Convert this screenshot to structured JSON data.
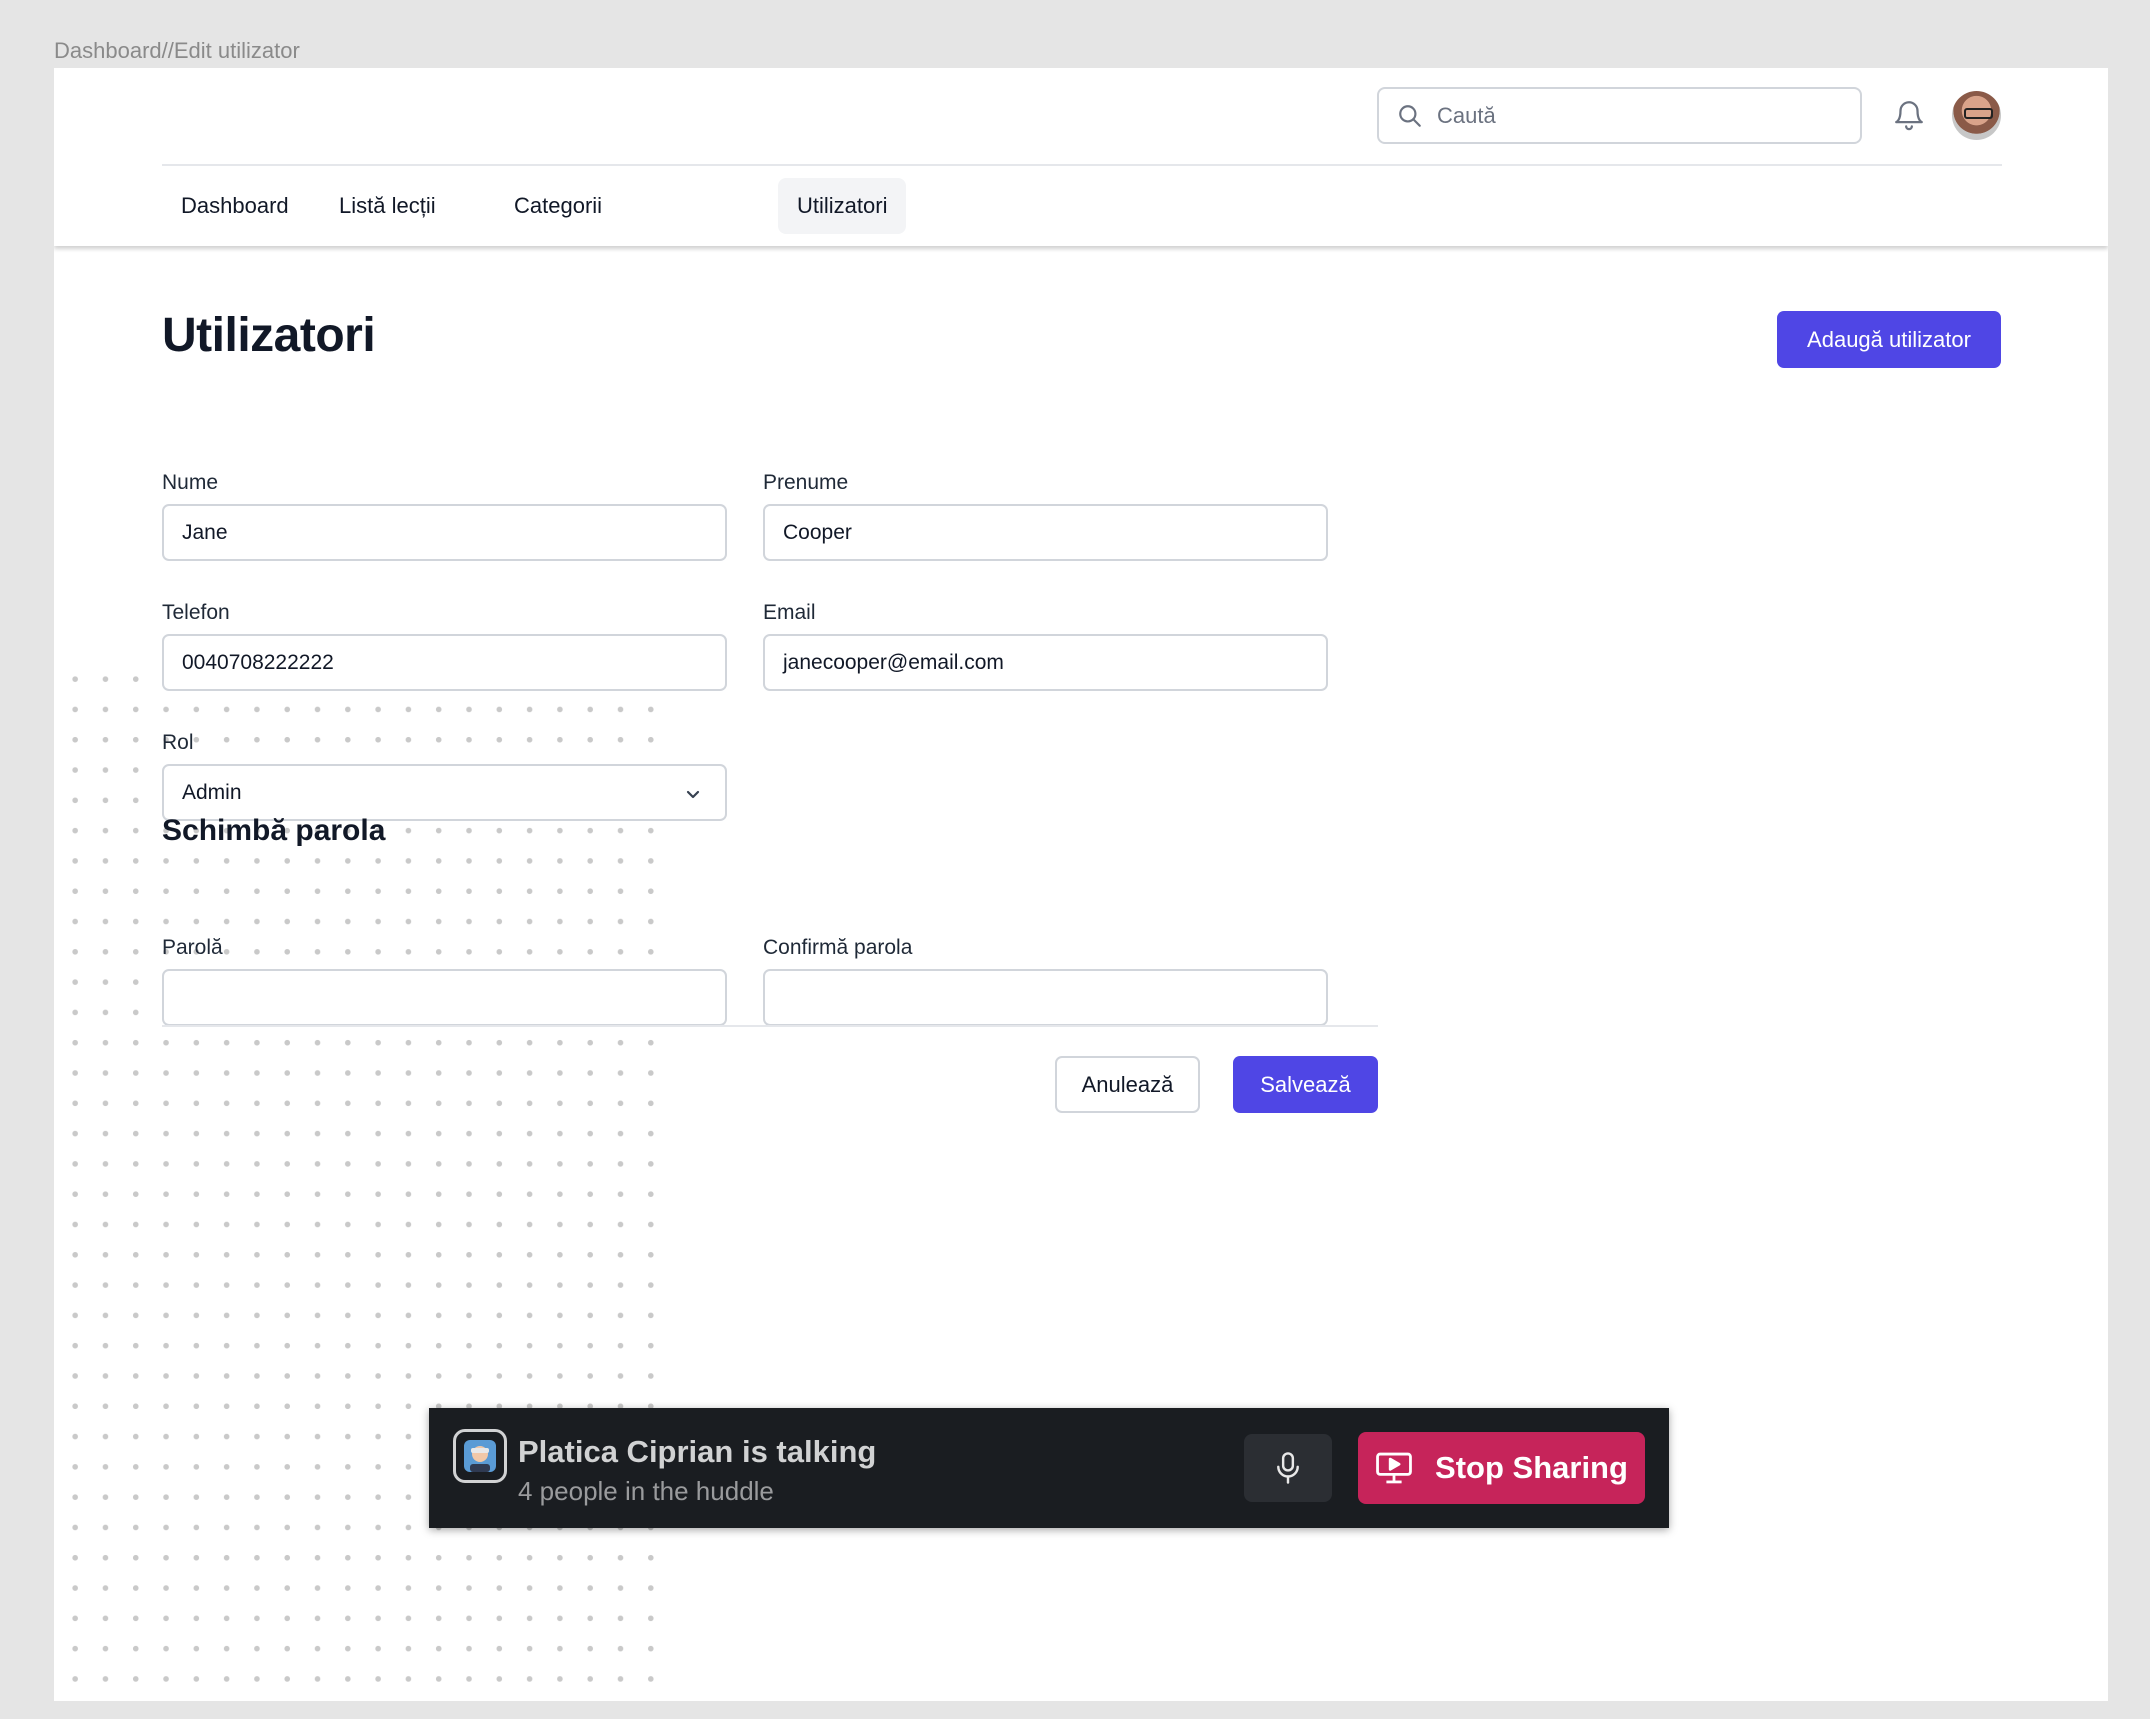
{
  "frame": {
    "label": "Dashboard//Edit utilizator"
  },
  "header": {
    "search": {
      "placeholder": "Caută"
    },
    "icons": {
      "search": "search-icon",
      "notifications": "bell-icon",
      "avatar": "user-avatar"
    },
    "tabs": [
      {
        "label": "Dashboard",
        "active": false
      },
      {
        "label": "Listă lecții",
        "active": false
      },
      {
        "label": "Categorii",
        "active": false
      },
      {
        "label": "Utilizatori",
        "active": true
      }
    ]
  },
  "page": {
    "title": "Utilizatori",
    "add_button": "Adaugă utilizator"
  },
  "form": {
    "nume": {
      "label": "Nume",
      "value": "Jane"
    },
    "prenume": {
      "label": "Prenume",
      "value": "Cooper"
    },
    "telefon": {
      "label": "Telefon",
      "value": "0040708222222"
    },
    "email": {
      "label": "Email",
      "value": "janecooper@email.com"
    },
    "rol": {
      "label": "Rol",
      "value": "Admin"
    },
    "password_section_title": "Schimbă parola",
    "parola": {
      "label": "Parolă",
      "value": ""
    },
    "confirma_parola": {
      "label": "Confirmă parola",
      "value": ""
    },
    "cancel_button": "Anulează",
    "save_button": "Salvează"
  },
  "huddle": {
    "title": "Platica Ciprian is talking",
    "subtitle": "4 people in the huddle",
    "stop_button": "Stop Sharing",
    "colors": {
      "bar": "#1a1d21",
      "stop": "#c6245a"
    }
  },
  "colors": {
    "accent": "#4f46e5",
    "border": "#d1d5db",
    "background": "#e5e5e5"
  }
}
